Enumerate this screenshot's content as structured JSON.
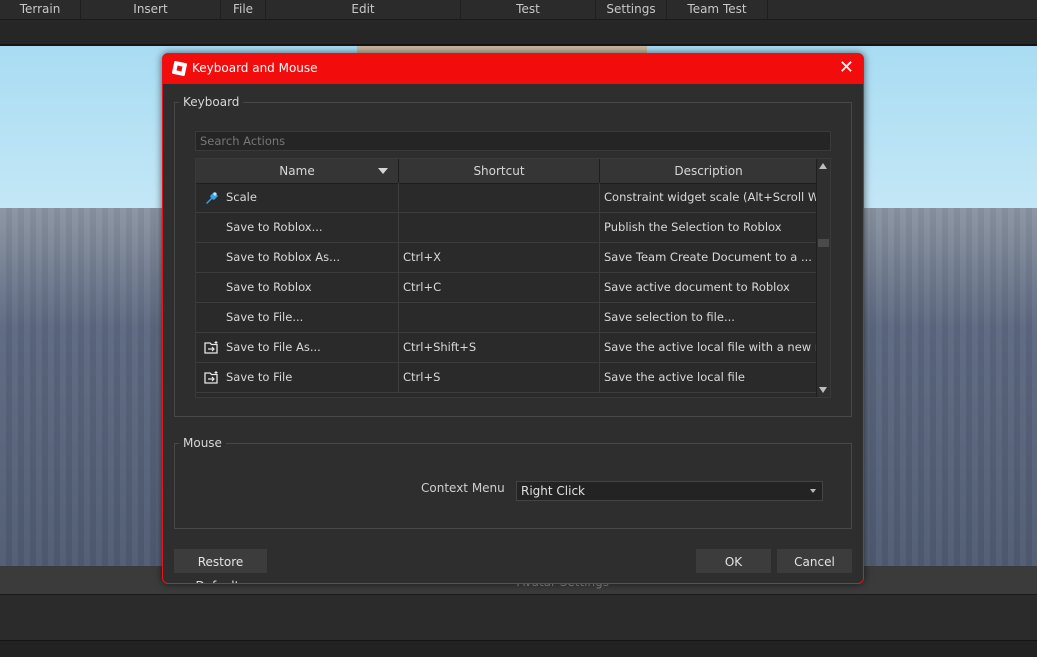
{
  "menu_tabs": [
    "Terrain",
    "Insert",
    "File",
    "Edit",
    "Test",
    "Settings",
    "Team Test"
  ],
  "background": {
    "bottom_label": "Avatar Settings"
  },
  "dialog": {
    "title": "Keyboard and Mouse",
    "close_icon": "close-icon",
    "keyboard_group": "Keyboard",
    "search_placeholder": "Search Actions",
    "columns": {
      "name": "Name",
      "shortcut": "Shortcut",
      "description": "Description"
    },
    "rows": [
      {
        "icon": "scale-icon",
        "name": "Scale",
        "shortcut": "",
        "description": "Constraint widget scale (Alt+Scroll Wheel)"
      },
      {
        "icon": "",
        "name": "Save to Roblox...",
        "shortcut": "",
        "description": "Publish the Selection to Roblox"
      },
      {
        "icon": "",
        "name": "Save to Roblox As...",
        "shortcut": "Ctrl+X",
        "description": "Save Team Create Document to a ..."
      },
      {
        "icon": "",
        "name": "Save to Roblox",
        "shortcut": "Ctrl+C",
        "description": "Save active document to Roblox"
      },
      {
        "icon": "",
        "name": "Save to File...",
        "shortcut": "",
        "description": "Save selection to file..."
      },
      {
        "icon": "folder-save-icon",
        "name": "Save to File As...",
        "shortcut": "Ctrl+Shift+S",
        "description": "Save the active local file with a new name"
      },
      {
        "icon": "folder-save-icon",
        "name": "Save to File",
        "shortcut": "Ctrl+S",
        "description": "Save the active local file"
      }
    ],
    "mouse_group": "Mouse",
    "context_menu_label": "Context Menu",
    "context_menu_value": "Right Click",
    "restore_defaults": "Restore Defaults",
    "ok": "OK",
    "cancel": "Cancel"
  },
  "colors": {
    "title_bar": "#f20c0c",
    "dialog_bg": "#2e2e2e",
    "accent_icon": "#3aa0e6"
  }
}
